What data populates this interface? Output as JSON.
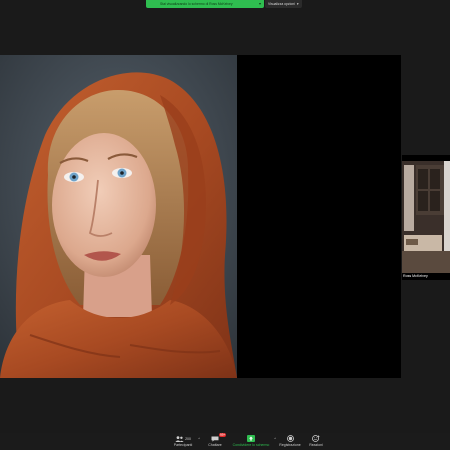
{
  "top_bar": {
    "share_status": "Stai visualizzando lo schermo di Ross McKelvey",
    "view_options": "Visualizza opzioni"
  },
  "participant": {
    "name": "Ross McKelvey"
  },
  "toolbar": {
    "participants_label": "Partecipanti",
    "participants_count": "200",
    "chat_label": "Chattare",
    "chat_badge": "99+",
    "share_label": "Condividere lo schermo",
    "record_label": "Registrazione",
    "reactions_label": "Reazioni"
  },
  "colors": {
    "share_banner": "#2fbe50",
    "background": "#1a1a1a",
    "scarf": "#b4502a",
    "badge": "#e02828"
  }
}
